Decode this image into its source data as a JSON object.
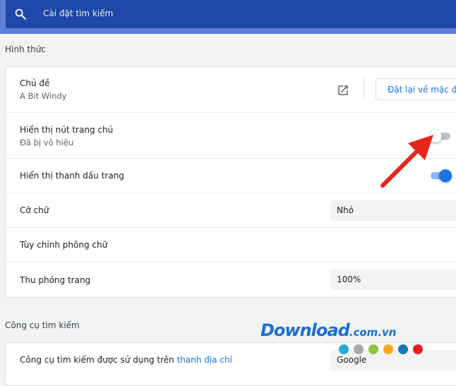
{
  "search": {
    "placeholder": "Cài đặt tìm kiếm"
  },
  "appearance": {
    "section_title": "Hình thức",
    "theme": {
      "label": "Chủ đề",
      "value": "A Bit Windy",
      "reset_label": "Đặt lại về mặc định"
    },
    "home_button": {
      "label": "Hiển thị nút trang chủ",
      "status": "Đã bị vô hiệu",
      "enabled": false
    },
    "bookmarks_bar": {
      "label": "Hiển thị thanh dấu trang",
      "enabled": true
    },
    "font_size": {
      "label": "Cỡ chữ",
      "value": "Nhỏ"
    },
    "customize_fonts": {
      "label": "Tùy chỉnh phông chữ"
    },
    "page_zoom": {
      "label": "Thu phóng trang",
      "value": "100%"
    }
  },
  "search_engine": {
    "section_title": "Công cụ tìm kiếm",
    "row_label_prefix": "Công cụ tìm kiếm được sử dụng trên",
    "row_label_link": "thanh địa chỉ",
    "value": "Google"
  },
  "watermark": {
    "text": "Download",
    "domain": ".com.vn",
    "dot_colors": [
      "#29a9e1",
      "#a7a9ac",
      "#8dc63f",
      "#f7a823",
      "#1b75bb",
      "#ed1c24"
    ]
  },
  "colors": {
    "header_bg": "#1e47a8",
    "accent": "#1a73e8",
    "annotation_arrow": "#e8271c"
  },
  "icons": {
    "search": "search-icon",
    "external_link": "external-link-icon",
    "annotation": "red-arrow-icon"
  }
}
